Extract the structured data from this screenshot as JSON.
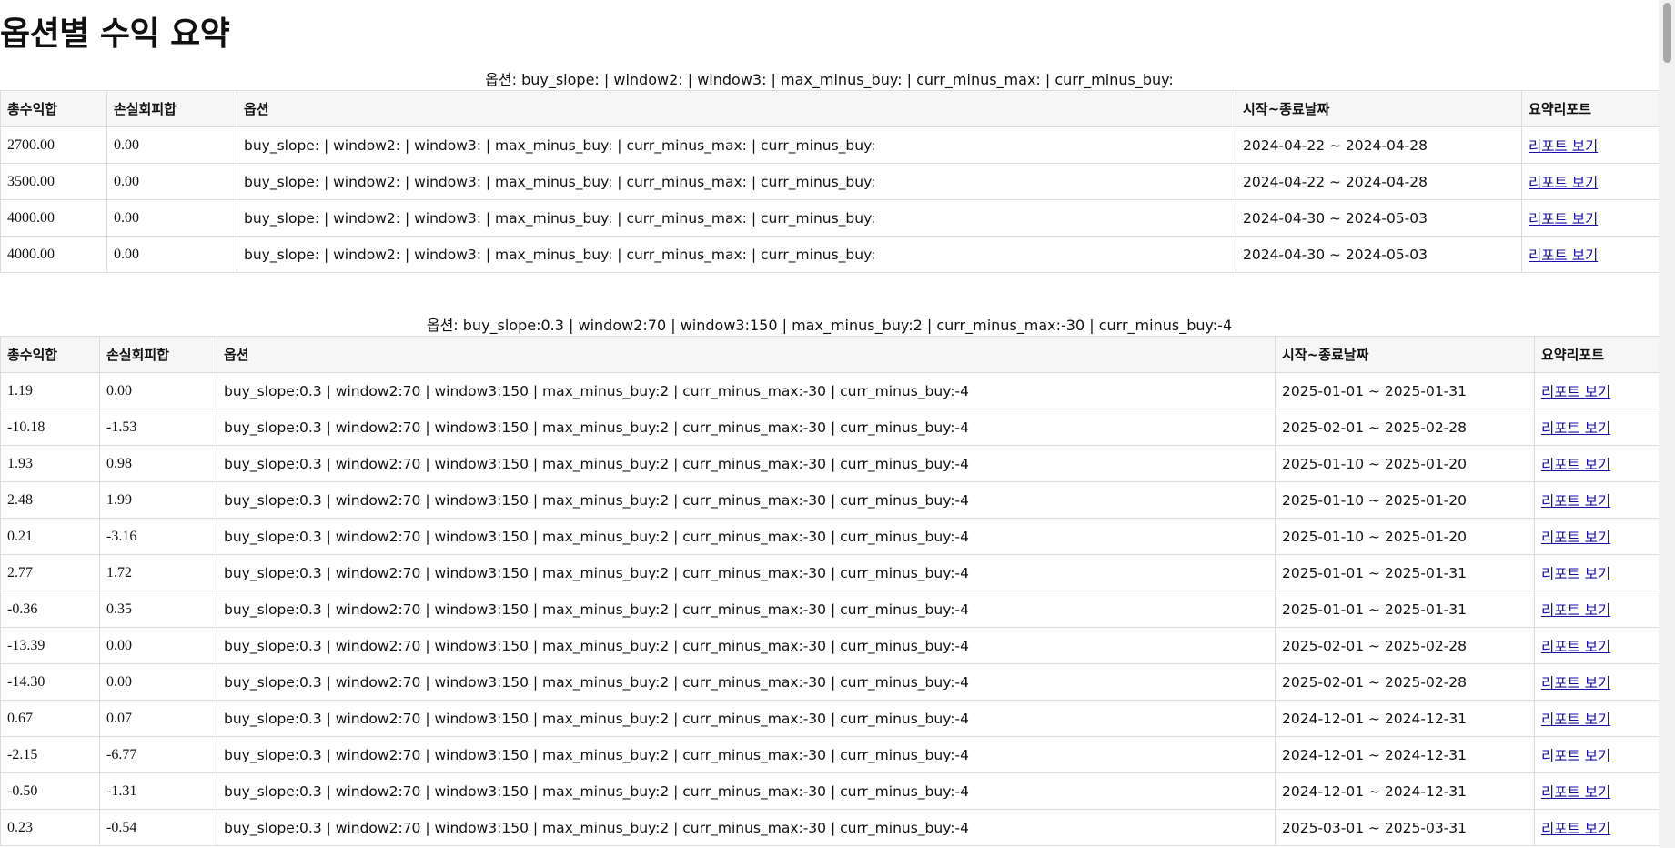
{
  "page": {
    "title": "옵션별 수익 요약"
  },
  "columns": [
    "총수익합",
    "손실회피합",
    "옵션",
    "시작~종료날짜",
    "요약리포트"
  ],
  "report_link_label": "리포트 보기",
  "sections": [
    {
      "caption": "옵션: buy_slope: | window2: | window3: | max_minus_buy: | curr_minus_max: | curr_minus_buy:",
      "rows": [
        {
          "total": "2700.00",
          "avoid": "0.00",
          "options": "buy_slope: | window2: | window3: | max_minus_buy: | curr_minus_max: | curr_minus_buy:",
          "period": "2024-04-22 ~ 2024-04-28"
        },
        {
          "total": "3500.00",
          "avoid": "0.00",
          "options": "buy_slope: | window2: | window3: | max_minus_buy: | curr_minus_max: | curr_minus_buy:",
          "period": "2024-04-22 ~ 2024-04-28"
        },
        {
          "total": "4000.00",
          "avoid": "0.00",
          "options": "buy_slope: | window2: | window3: | max_minus_buy: | curr_minus_max: | curr_minus_buy:",
          "period": "2024-04-30 ~ 2024-05-03"
        },
        {
          "total": "4000.00",
          "avoid": "0.00",
          "options": "buy_slope: | window2: | window3: | max_minus_buy: | curr_minus_max: | curr_minus_buy:",
          "period": "2024-04-30 ~ 2024-05-03"
        }
      ]
    },
    {
      "caption": "옵션: buy_slope:0.3 | window2:70 | window3:150 | max_minus_buy:2 | curr_minus_max:-30 | curr_minus_buy:-4",
      "rows": [
        {
          "total": "1.19",
          "avoid": "0.00",
          "options": "buy_slope:0.3 | window2:70 | window3:150 | max_minus_buy:2 | curr_minus_max:-30 | curr_minus_buy:-4",
          "period": "2025-01-01 ~ 2025-01-31"
        },
        {
          "total": "-10.18",
          "avoid": "-1.53",
          "options": "buy_slope:0.3 | window2:70 | window3:150 | max_minus_buy:2 | curr_minus_max:-30 | curr_minus_buy:-4",
          "period": "2025-02-01 ~ 2025-02-28"
        },
        {
          "total": "1.93",
          "avoid": "0.98",
          "options": "buy_slope:0.3 | window2:70 | window3:150 | max_minus_buy:2 | curr_minus_max:-30 | curr_minus_buy:-4",
          "period": "2025-01-10 ~ 2025-01-20"
        },
        {
          "total": "2.48",
          "avoid": "1.99",
          "options": "buy_slope:0.3 | window2:70 | window3:150 | max_minus_buy:2 | curr_minus_max:-30 | curr_minus_buy:-4",
          "period": "2025-01-10 ~ 2025-01-20"
        },
        {
          "total": "0.21",
          "avoid": "-3.16",
          "options": "buy_slope:0.3 | window2:70 | window3:150 | max_minus_buy:2 | curr_minus_max:-30 | curr_minus_buy:-4",
          "period": "2025-01-10 ~ 2025-01-20"
        },
        {
          "total": "2.77",
          "avoid": "1.72",
          "options": "buy_slope:0.3 | window2:70 | window3:150 | max_minus_buy:2 | curr_minus_max:-30 | curr_minus_buy:-4",
          "period": "2025-01-01 ~ 2025-01-31"
        },
        {
          "total": "-0.36",
          "avoid": "0.35",
          "options": "buy_slope:0.3 | window2:70 | window3:150 | max_minus_buy:2 | curr_minus_max:-30 | curr_minus_buy:-4",
          "period": "2025-01-01 ~ 2025-01-31"
        },
        {
          "total": "-13.39",
          "avoid": "0.00",
          "options": "buy_slope:0.3 | window2:70 | window3:150 | max_minus_buy:2 | curr_minus_max:-30 | curr_minus_buy:-4",
          "period": "2025-02-01 ~ 2025-02-28"
        },
        {
          "total": "-14.30",
          "avoid": "0.00",
          "options": "buy_slope:0.3 | window2:70 | window3:150 | max_minus_buy:2 | curr_minus_max:-30 | curr_minus_buy:-4",
          "period": "2025-02-01 ~ 2025-02-28"
        },
        {
          "total": "0.67",
          "avoid": "0.07",
          "options": "buy_slope:0.3 | window2:70 | window3:150 | max_minus_buy:2 | curr_minus_max:-30 | curr_minus_buy:-4",
          "period": "2024-12-01 ~ 2024-12-31"
        },
        {
          "total": "-2.15",
          "avoid": "-6.77",
          "options": "buy_slope:0.3 | window2:70 | window3:150 | max_minus_buy:2 | curr_minus_max:-30 | curr_minus_buy:-4",
          "period": "2024-12-01 ~ 2024-12-31"
        },
        {
          "total": "-0.50",
          "avoid": "-1.31",
          "options": "buy_slope:0.3 | window2:70 | window3:150 | max_minus_buy:2 | curr_minus_max:-30 | curr_minus_buy:-4",
          "period": "2024-12-01 ~ 2024-12-31"
        },
        {
          "total": "0.23",
          "avoid": "-0.54",
          "options": "buy_slope:0.3 | window2:70 | window3:150 | max_minus_buy:2 | curr_minus_max:-30 | curr_minus_buy:-4",
          "period": "2025-03-01 ~ 2025-03-31"
        }
      ]
    }
  ]
}
